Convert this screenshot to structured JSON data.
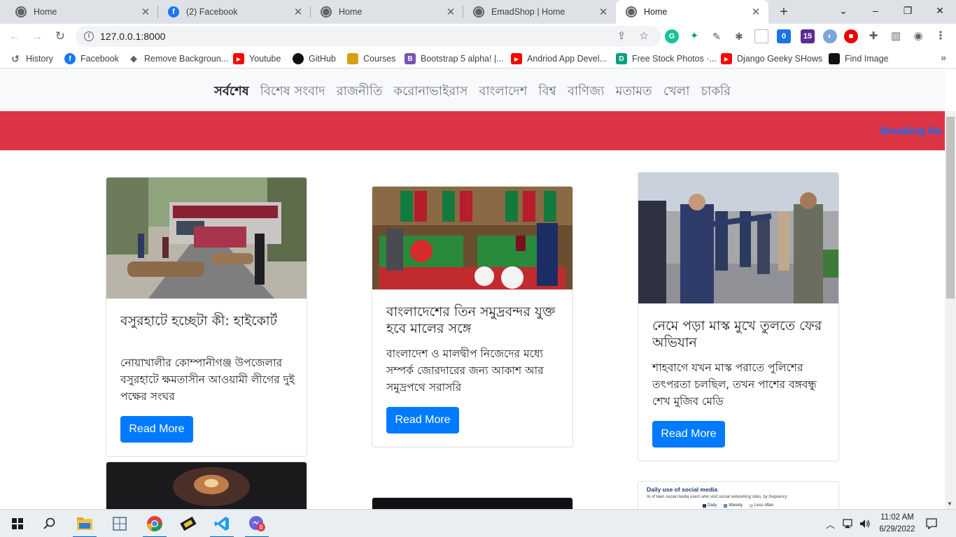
{
  "browser": {
    "tabs": [
      {
        "title": "Home",
        "favicon": "globe-icon",
        "active": false
      },
      {
        "title": "(2) Facebook",
        "favicon": "facebook-icon",
        "active": false
      },
      {
        "title": "Home",
        "favicon": "globe-icon",
        "active": false
      },
      {
        "title": "EmadShop | Home",
        "favicon": "globe-icon",
        "active": false
      },
      {
        "title": "Home",
        "favicon": "globe-icon",
        "active": true
      }
    ],
    "tab_close_glyph": "✕",
    "new_tab_glyph": "+",
    "url": "127.0.0.1:8000",
    "bookmarks": [
      {
        "label": "History",
        "icon": "history-icon",
        "color": "#5f6368"
      },
      {
        "label": "Facebook",
        "icon": "facebook-icon",
        "color": "#1877f2"
      },
      {
        "label": "Remove Backgroun...",
        "icon": "layers-icon",
        "color": "#5f6368"
      },
      {
        "label": "Youtube",
        "icon": "youtube-icon",
        "color": "#ff0000"
      },
      {
        "label": "GitHub",
        "icon": "github-icon",
        "color": "#111111"
      },
      {
        "label": "Courses",
        "icon": "courses-icon",
        "color": "#d4a017"
      },
      {
        "label": "Bootstrap 5 alpha! |...",
        "icon": "bootstrap-icon",
        "color": "#7952b3"
      },
      {
        "label": "Andriod App Devel...",
        "icon": "youtube-icon",
        "color": "#ff0000"
      },
      {
        "label": "Free Stock Photos ·...",
        "icon": "stock-photos-icon",
        "color": "#05a081"
      },
      {
        "label": "Django Geeky SHows",
        "icon": "youtube-icon",
        "color": "#ff0000"
      },
      {
        "label": "Find Image",
        "icon": "find-image-icon",
        "color": "#111111"
      }
    ],
    "extension_badges": {
      "badge_a": "0",
      "badge_b": "15"
    }
  },
  "site": {
    "nav": [
      "সর্বশেষ",
      "বিশেষ সংবাদ",
      "রাজনীতি",
      "করোনাভাইরাস",
      "বাংলাদেশ",
      "বিশ্ব",
      "বাণিজ্য",
      "মতামত",
      "খেলা",
      "চাকরি"
    ],
    "active_nav": "সর্বশেষ",
    "breaking_text": "Breaking Ne",
    "colors": {
      "breaking_bg": "#dc3545",
      "button_bg": "#007bff",
      "ticker": "#0d6efd"
    },
    "cards": [
      {
        "title": "বসুরহাটে হচ্ছেটা কী: হাইকোর্ট",
        "description": "নোয়াখালীর কোম্পানীগঞ্জ উপজেলার বসুরহাটে ক্ষমতাসীন আওয়ামী লীগের দুই পক্ষের সংঘর",
        "button": "Read More"
      },
      {
        "title": "বাংলাদেশের তিন সমুদ্রবন্দর যুক্ত হবে মালের সঙ্গে",
        "description": "বাংলাদেশ ও মালদ্বীপ নিজেদের মধ্যে সম্পর্ক জোরদারের জন্য আকাশ আর সমুদ্রপথে সরাসরি",
        "button": "Read More"
      },
      {
        "title": "নেমে পড়া মাস্ক মুখে তুলতে ফের অভিযান",
        "description": "শাহবাগে যখন মাস্ক পরাতে পুলিশের তৎপরতা চলছিল, তখন পাশের বঙ্গবন্ধু শেখ মুজিব মেডি",
        "button": "Read More"
      }
    ],
    "chart_thumb": {
      "title": "Daily use of social media",
      "subtitle": "% of teen social media users who visit social networking sites, by frequency",
      "legend": [
        "Daily",
        "Weekly",
        "Less often"
      ]
    }
  },
  "taskbar": {
    "time": "11:02 AM",
    "date": "6/29/2022",
    "badge": "8"
  }
}
